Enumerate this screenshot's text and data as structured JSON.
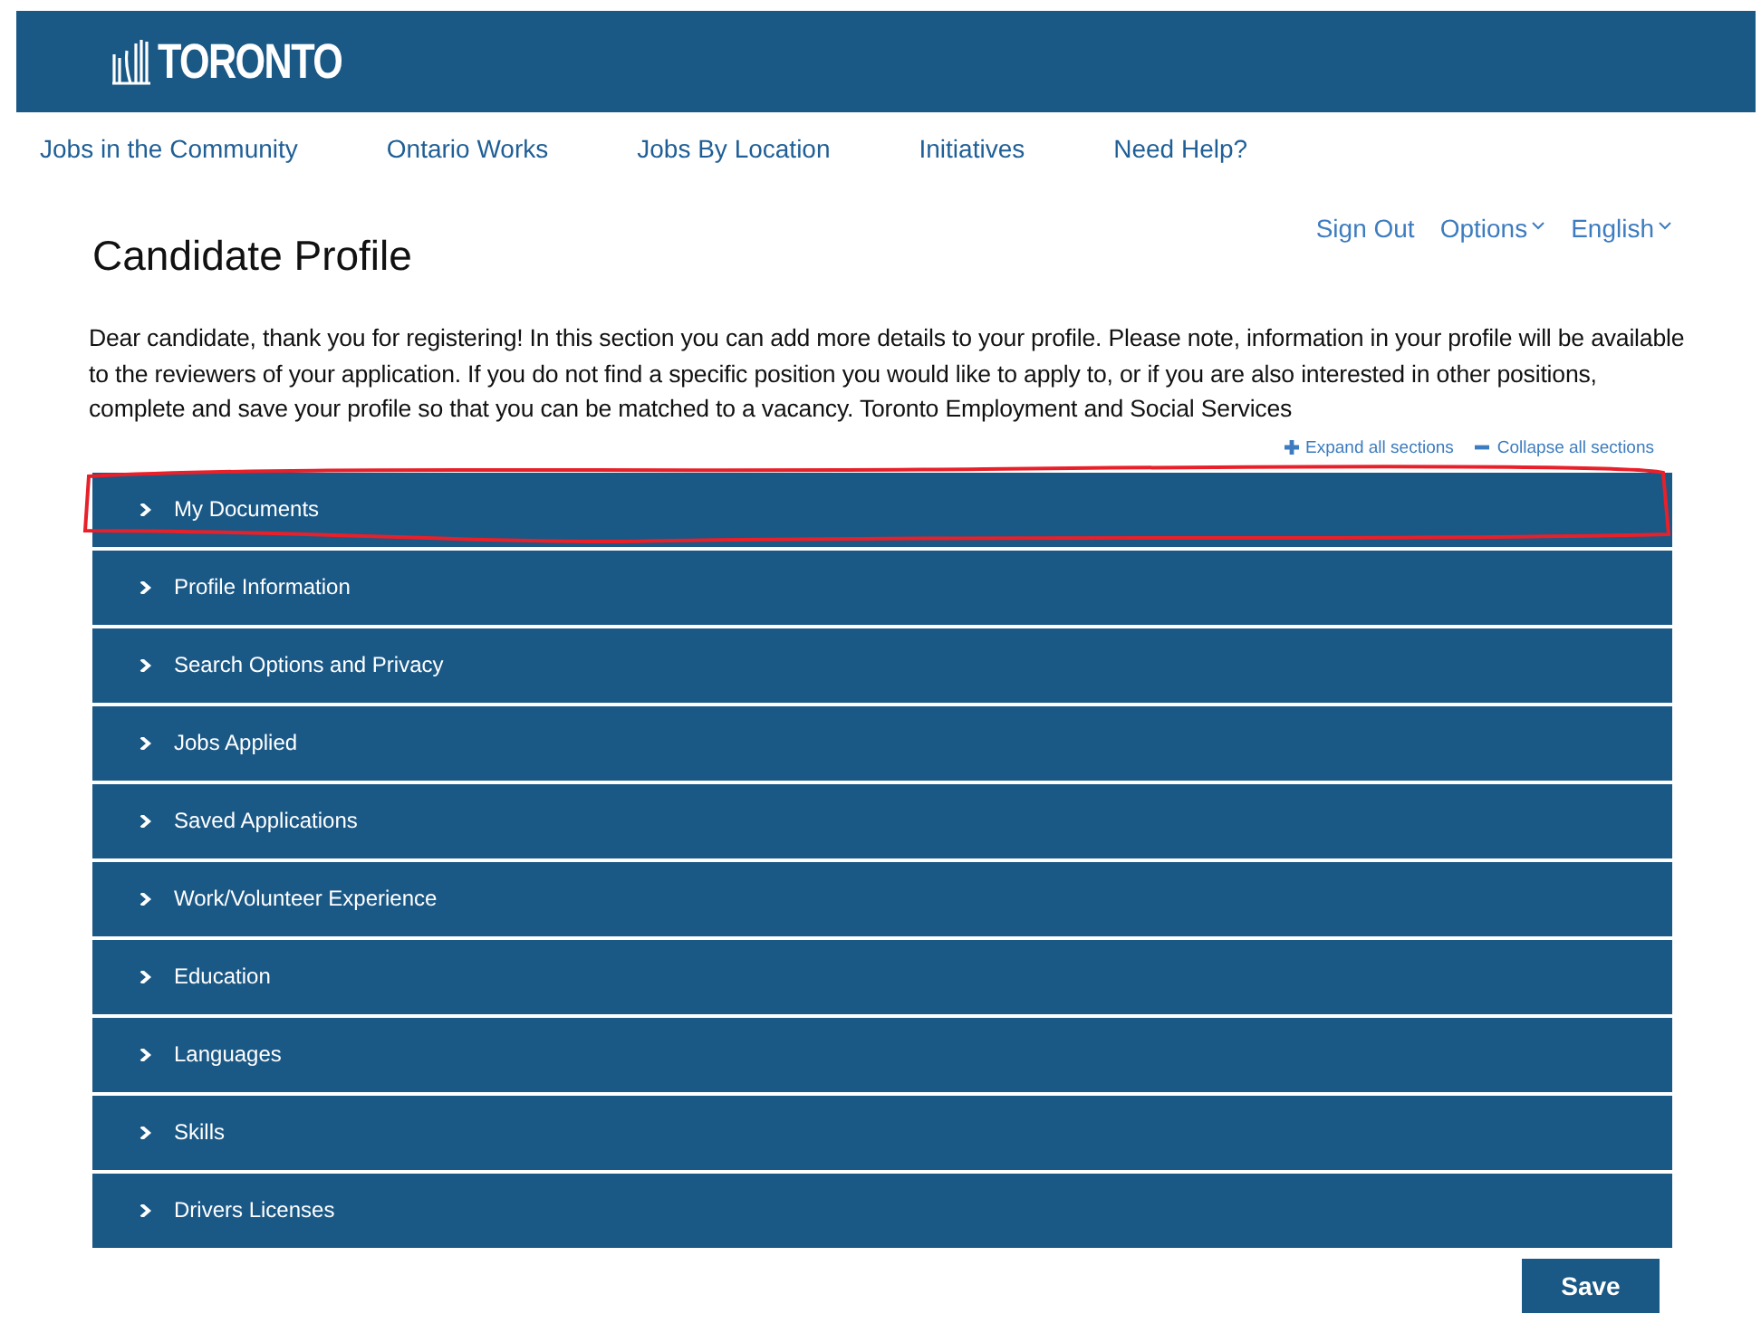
{
  "header": {
    "logo": "TORONTO"
  },
  "nav": [
    {
      "label": "Jobs in the Community"
    },
    {
      "label": "Ontario Works"
    },
    {
      "label": "Jobs By Location"
    },
    {
      "label": "Initiatives"
    },
    {
      "label": "Need Help?"
    }
  ],
  "user_links": [
    {
      "label": "Sign Out",
      "kind": "link"
    },
    {
      "label": "Options",
      "kind": "dropdown"
    },
    {
      "label": "English",
      "kind": "dropdown"
    }
  ],
  "title": "Candidate Profile",
  "intro": "Dear candidate, thank you for registering! In this section you can add more details to your profile. Please note, information in your profile will be available to the reviewers of your application. If you do not find a specific position you would like to apply to, or if you are also interested in other positions, complete and save your profile so that you can be matched to a vacancy. Toronto Employment and Social Services",
  "section_controls": [
    {
      "label": "Expand all sections",
      "kind": "expand"
    },
    {
      "label": "Collapse all sections",
      "kind": "collapse"
    }
  ],
  "sections": [
    {
      "label": "My Documents",
      "expanded": false,
      "highlighted": true
    },
    {
      "label": "Profile Information",
      "expanded": false,
      "highlighted": false
    },
    {
      "label": "Search Options and Privacy",
      "expanded": false,
      "highlighted": false
    },
    {
      "label": "Jobs Applied",
      "expanded": false,
      "highlighted": false
    },
    {
      "label": "Saved Applications",
      "expanded": false,
      "highlighted": false
    },
    {
      "label": "Work/Volunteer Experience",
      "expanded": false,
      "highlighted": false
    },
    {
      "label": "Education",
      "expanded": false,
      "highlighted": false
    },
    {
      "label": "Languages",
      "expanded": false,
      "highlighted": false
    },
    {
      "label": "Skills",
      "expanded": false,
      "highlighted": false
    },
    {
      "label": "Drivers Licenses",
      "expanded": false,
      "highlighted": false
    }
  ],
  "save_button": "Save"
}
